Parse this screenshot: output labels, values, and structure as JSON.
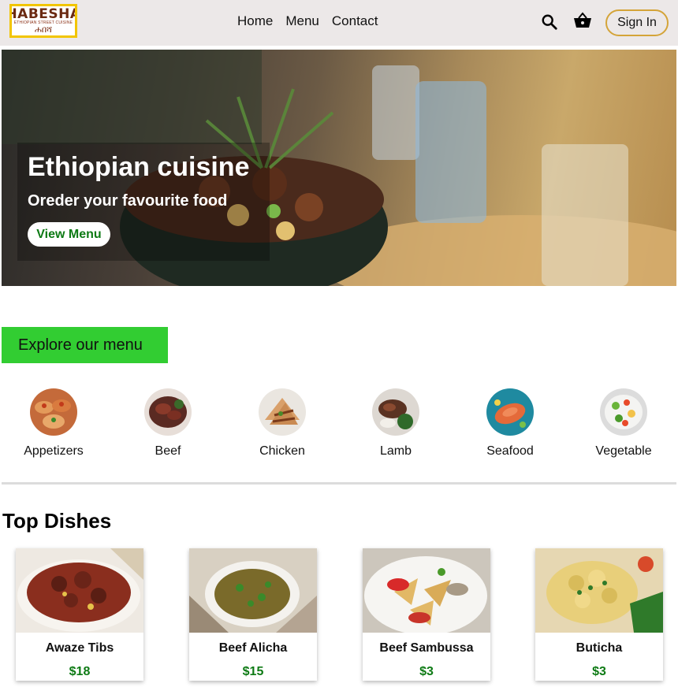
{
  "brand": {
    "logo_text": "HABESHA",
    "logo_subtext": "ETHIOPIAN STREET CUISINE",
    "logo_amharic": "ሐበሻ"
  },
  "nav": {
    "items": [
      "Home",
      "Menu",
      "Contact"
    ]
  },
  "header": {
    "signin_label": "Sign In"
  },
  "hero": {
    "title": "Ethiopian cuisine",
    "subtitle": "Oreder your favourite food",
    "cta_label": "View Menu"
  },
  "explore": {
    "label": "Explore our menu"
  },
  "categories": [
    {
      "label": "Appetizers"
    },
    {
      "label": "Beef"
    },
    {
      "label": "Chicken"
    },
    {
      "label": "Lamb"
    },
    {
      "label": "Seafood"
    },
    {
      "label": "Vegetable"
    }
  ],
  "top_dishes": {
    "title": "Top Dishes",
    "items": [
      {
        "name": "Awaze Tibs",
        "price": "$18"
      },
      {
        "name": "Beef Alicha",
        "price": "$15"
      },
      {
        "name": "Beef Sambussa",
        "price": "$3"
      },
      {
        "name": "Buticha",
        "price": "$3"
      }
    ]
  },
  "colors": {
    "accent_green": "#32cd32",
    "price_green": "#0d7a14",
    "signin_border": "#d4a439",
    "header_bg": "#ece8e8",
    "logo_border": "#f2c500"
  }
}
